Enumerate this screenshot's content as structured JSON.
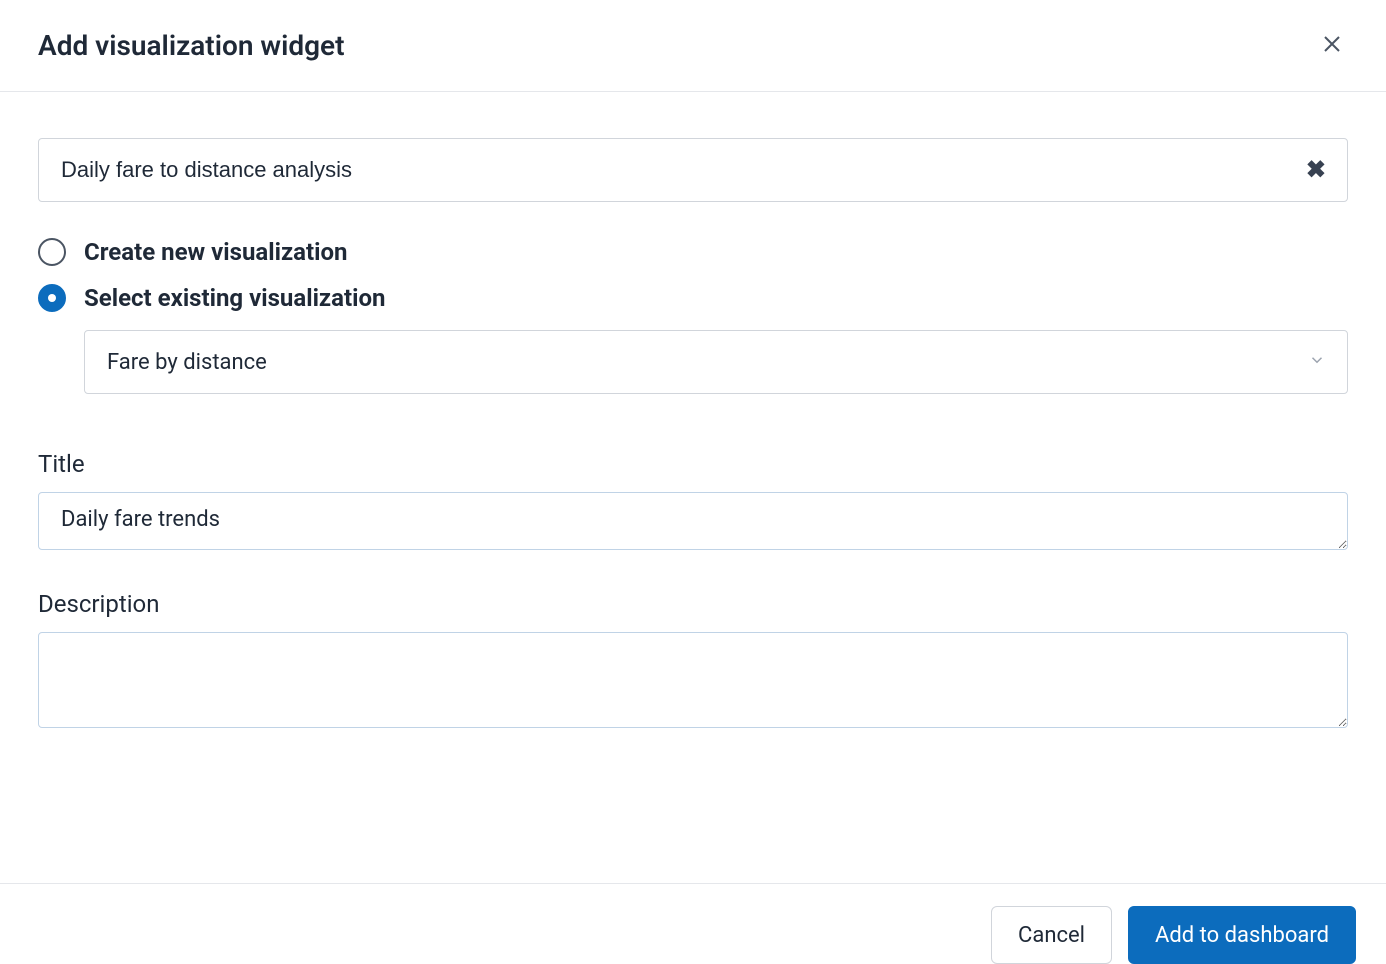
{
  "modal": {
    "title": "Add visualization widget"
  },
  "search": {
    "value": "Daily fare to distance analysis"
  },
  "radios": {
    "create_label": "Create new visualization",
    "select_label": "Select existing visualization",
    "selected": "existing"
  },
  "existing_select": {
    "value": "Fare by distance"
  },
  "form": {
    "title_label": "Title",
    "title_value": "Daily fare trends",
    "description_label": "Description",
    "description_value": ""
  },
  "footer": {
    "cancel_label": "Cancel",
    "submit_label": "Add to dashboard"
  }
}
